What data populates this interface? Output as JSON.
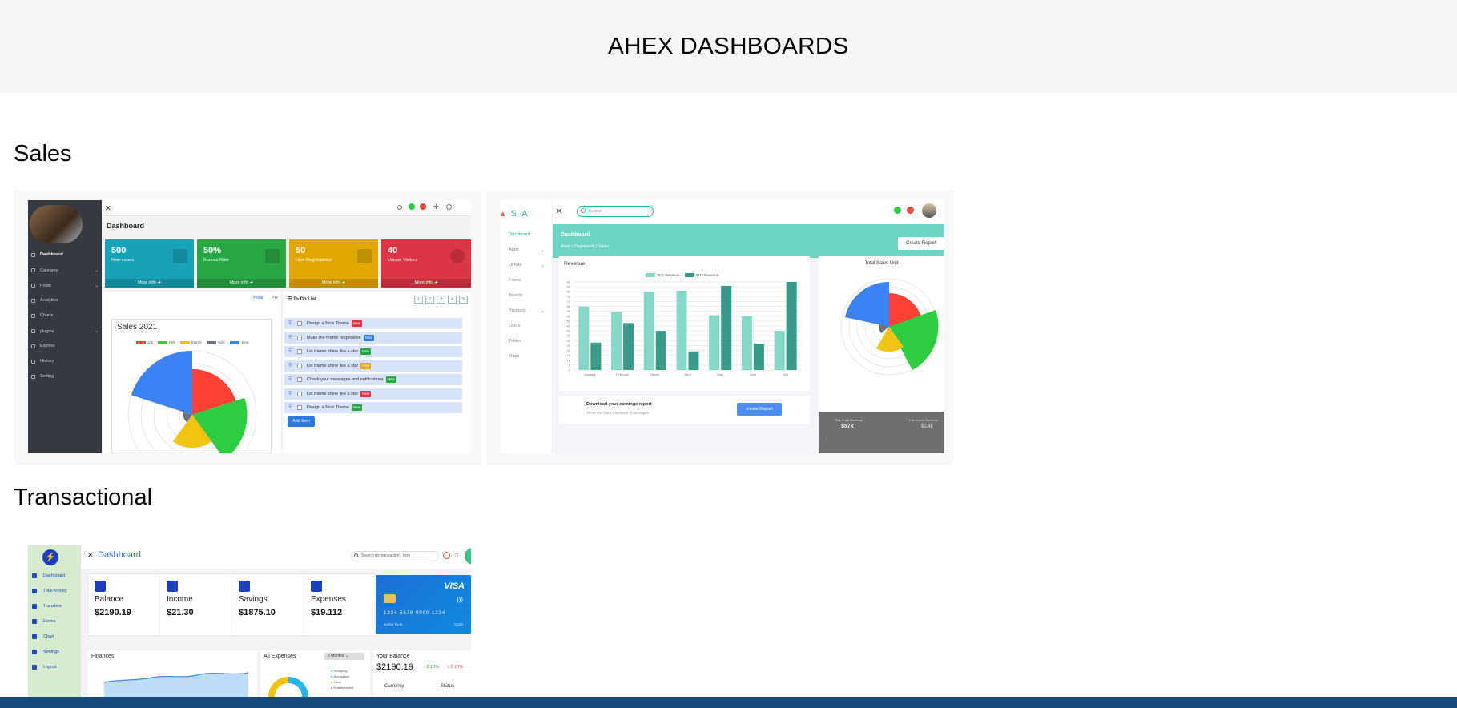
{
  "page": {
    "title": "AHEX DASHBOARDS"
  },
  "sections": [
    {
      "title": "Sales"
    },
    {
      "title": "Transactional"
    }
  ],
  "sales_dash_1": {
    "title": "Dashboard",
    "sidebar": [
      "Dashboard",
      "Category",
      "Posts",
      "Analytics",
      "Charts",
      "plugins",
      "Explore",
      "History",
      "Setting"
    ],
    "stats": [
      {
        "value": "500",
        "label": "New orders",
        "more": "More info",
        "color": "#17a2b8"
      },
      {
        "value": "50%",
        "label": "Bounce Rate",
        "more": "More info",
        "color": "#28a745"
      },
      {
        "value": "50",
        "label": "User Registrations",
        "more": "More info",
        "color": "#e0a800"
      },
      {
        "value": "40",
        "label": "Unique Visitors",
        "more": "More info",
        "color": "#dc3545"
      }
    ],
    "tabs": [
      "Polar",
      "Pie"
    ],
    "chart_title": "Sales 2021",
    "legend": [
      "Jan",
      "Feb",
      "March",
      "April",
      "June"
    ],
    "todo_title": "To Do List",
    "pages": [
      "1",
      "2",
      "3",
      "4",
      "5"
    ],
    "todos": [
      {
        "text": "Design a Nice Theme",
        "tag": "New",
        "color": "#dc3545"
      },
      {
        "text": "Make the theme responsive",
        "tag": "New",
        "color": "#2c7be5"
      },
      {
        "text": "Let theme shine like a star",
        "tag": "New",
        "color": "#28a745"
      },
      {
        "text": "Let theme shine like a star",
        "tag": "New",
        "color": "#e0a800"
      },
      {
        "text": "Check your messages and notifications",
        "tag": "New",
        "color": "#28a745"
      },
      {
        "text": "Let theme shine like a star",
        "tag": "New",
        "color": "#dc3545"
      },
      {
        "text": "Design a Nice Theme",
        "tag": "New",
        "color": "#28a745"
      }
    ],
    "add_item": "Add Item"
  },
  "sales_dash_2": {
    "logo": "S A",
    "search_placeholder": "Search",
    "nav": [
      "Dashboard",
      "Apps",
      "UI Kits",
      "Forms",
      "Boards",
      "Products",
      "Users",
      "Tables",
      "Maps"
    ],
    "title": "Dashboard",
    "breadcrumb": "Ahex > Dashboard > Sales",
    "create_report": "Create Report",
    "revenue": {
      "title": "Revenue",
      "legend": [
        "2021 Revenue",
        "2022 Revenue"
      ],
      "yticks": [
        "90",
        "85",
        "80",
        "75",
        "70",
        "65",
        "60",
        "55",
        "50",
        "45",
        "40",
        "35",
        "30",
        "25",
        "20",
        "15",
        "10",
        "5",
        "0"
      ]
    },
    "total_sales_title": "Total Sales Unit",
    "download_title": "Download your earnings report",
    "download_sub": "There are many variations of passages",
    "download_btn": "create Report",
    "bottom": {
      "left_label": "This Profit Revenue",
      "left_value": "$57k",
      "right_label": "This month Revenue",
      "right_value": "$14k"
    }
  },
  "chart_data": [
    {
      "type": "bar",
      "title": "Revenue",
      "categories": [
        "January",
        "February",
        "March",
        "April",
        "May",
        "June",
        "July"
      ],
      "series": [
        {
          "name": "2021 Revenue",
          "values": [
            65,
            59,
            80,
            81,
            56,
            55,
            40
          ],
          "color": "#85d7c8"
        },
        {
          "name": "2022 Revenue",
          "values": [
            28,
            48,
            40,
            19,
            86,
            27,
            90
          ],
          "color": "#3a9a8a"
        }
      ],
      "ylim": [
        0,
        90
      ]
    },
    {
      "type": "pie",
      "title": "Sales 2021",
      "labels": [
        "Jan",
        "Feb",
        "March",
        "April",
        "June"
      ],
      "values": [
        25,
        30,
        18,
        5,
        35
      ],
      "colors": [
        "#ff4136",
        "#2ecc40",
        "#f1c40f",
        "#6c757d",
        "#3b82f6"
      ]
    }
  ],
  "trans_dash": {
    "title": "Dashboard",
    "search_placeholder": "Search for transaction, item",
    "nav": [
      "Dashboard",
      "Total Money",
      "Transfers",
      "Forms",
      "Chart",
      "Settings",
      "Logout"
    ],
    "cards": [
      {
        "label": "Balance",
        "value": "$2190.19"
      },
      {
        "label": "Income",
        "value": "$21.30"
      },
      {
        "label": "Savings",
        "value": "$1875.10"
      },
      {
        "label": "Expenses",
        "value": "$19.112"
      }
    ],
    "visa": {
      "brand": "VISA",
      "number": "1234 5678 9000 1234",
      "name": "Jasha Tuna",
      "expiry": "12/24"
    },
    "finances_title": "Finances",
    "expenses_title": "All Expenses",
    "expenses_period": "6 Months",
    "expense_legend": [
      "Shopping",
      "Workspace",
      "Food",
      "Entertainment"
    ],
    "your_balance_title": "Your Balance",
    "your_balance_value": "$2190.19",
    "up": "↑ 2.10%",
    "down": "↓ 2.10%",
    "currency_label": "Currency",
    "status_label": "Status"
  }
}
